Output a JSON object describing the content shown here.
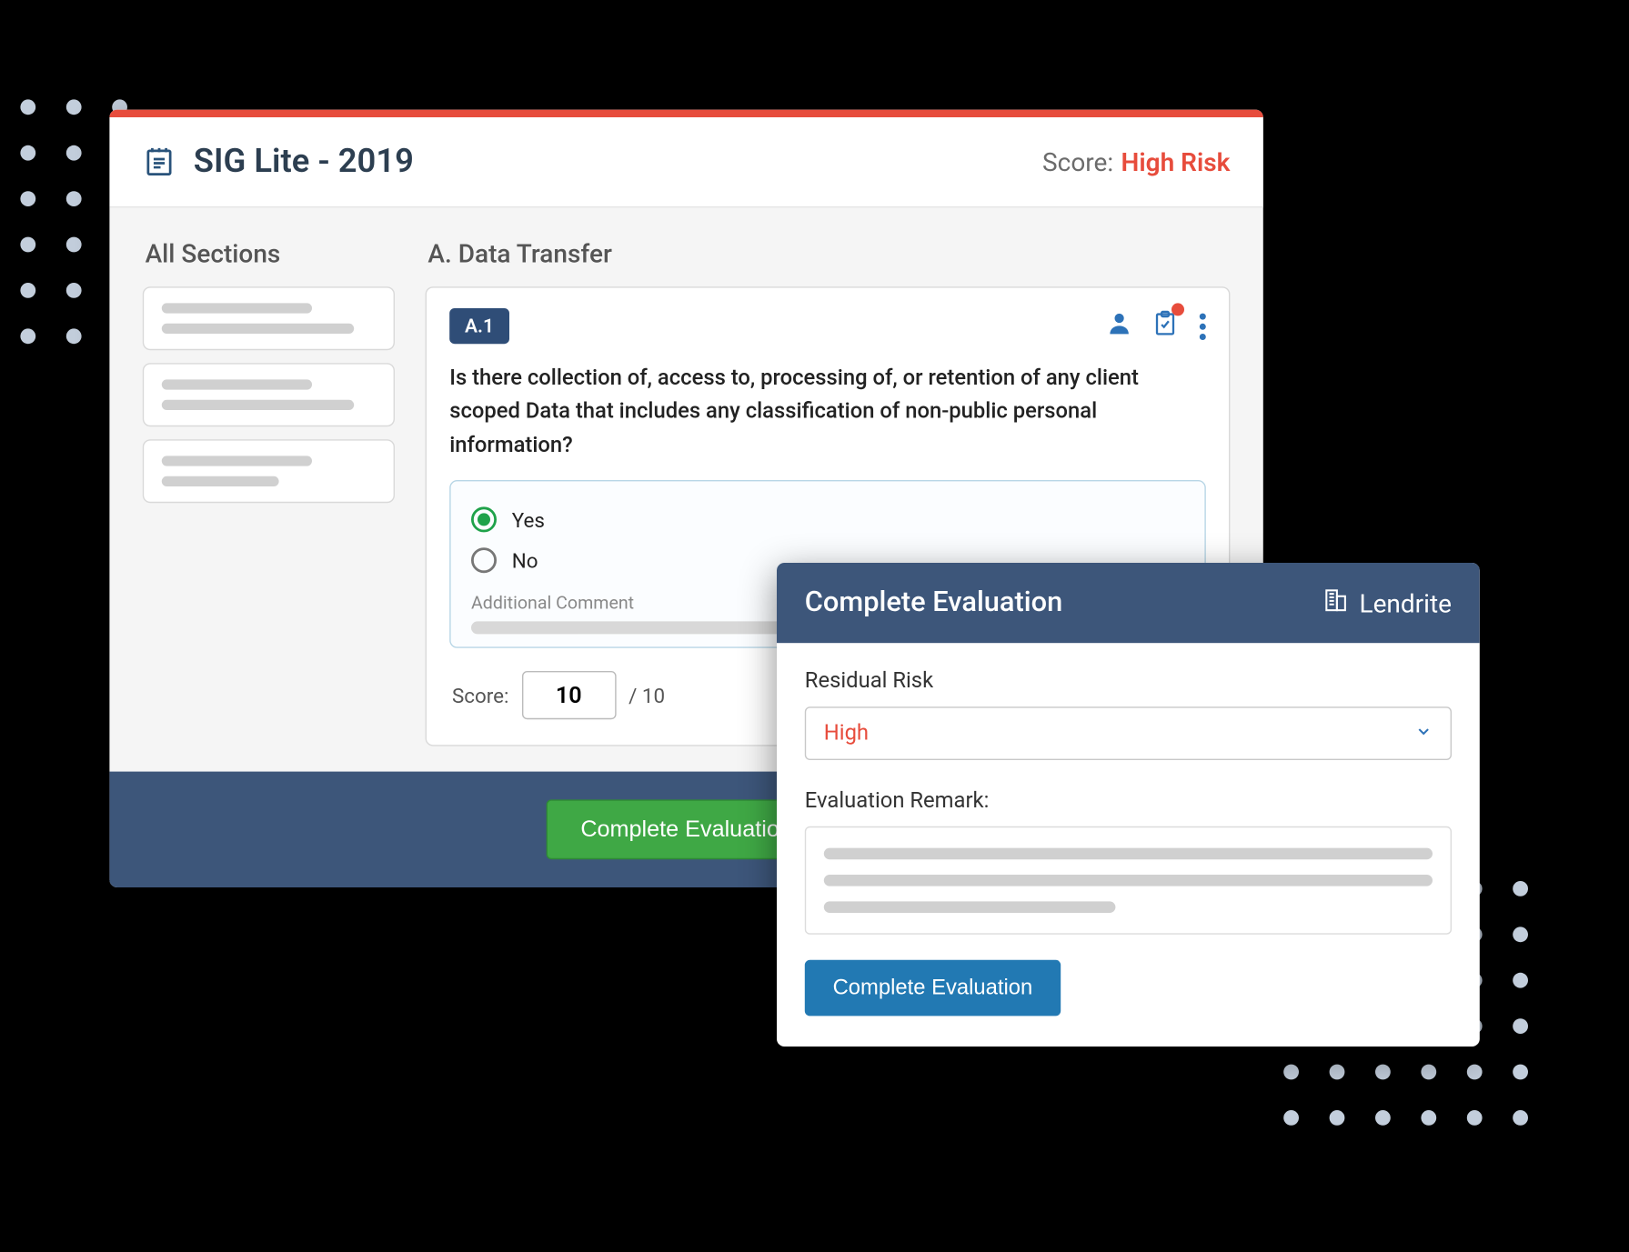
{
  "header": {
    "title": "SIG Lite - 2019",
    "score_label": "Score:",
    "score_value": "High Risk"
  },
  "sidebar": {
    "heading": "All Sections"
  },
  "question": {
    "section_heading": "A. Data Transfer",
    "tag": "A.1",
    "text": "Is there collection of, access to, processing of, or retention of any client scoped Data that includes any classification of non-public personal information?",
    "options": {
      "yes": "Yes",
      "no": "No"
    },
    "selected": "yes",
    "additional_comment_label": "Additional Comment",
    "score_label": "Score:",
    "score_value": "10",
    "score_max": "/ 10"
  },
  "footer": {
    "complete_button": "Complete Evaluation"
  },
  "modal": {
    "title": "Complete Evaluation",
    "brand": "Lendrite",
    "residual_risk_label": "Residual Risk",
    "residual_risk_value": "High",
    "remark_label": "Evaluation Remark:",
    "submit_button": "Complete Evaluation"
  }
}
